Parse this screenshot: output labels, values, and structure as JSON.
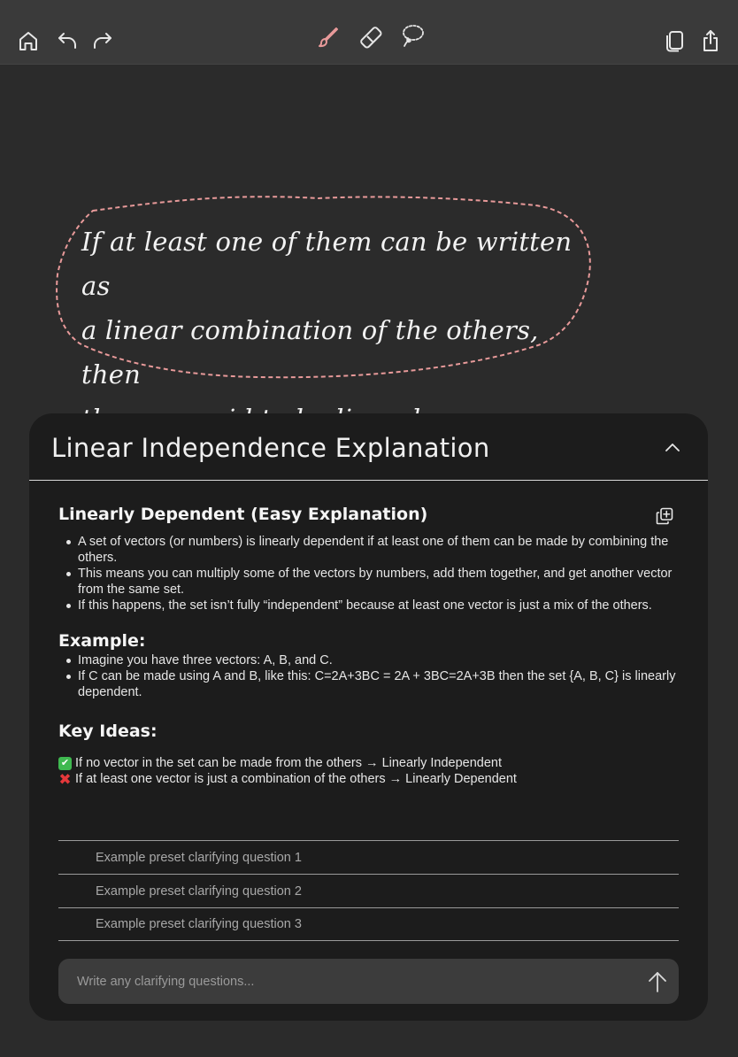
{
  "toolbar": {
    "left_icons": [
      "home-icon",
      "undo-icon",
      "redo-icon"
    ],
    "center_icons": [
      "pen-icon",
      "eraser-icon",
      "lasso-icon"
    ],
    "right_icons": [
      "pages-icon",
      "share-icon"
    ],
    "active_tool": "pen",
    "accent_color": "#e89a9a"
  },
  "note": {
    "lines": [
      "If at least one of them can be written as",
      "a linear combination of the others, then",
      "they are said to be linearly dependent."
    ],
    "lasso_color": "#e89a9a"
  },
  "panel": {
    "title": "Linear Independence Explanation",
    "section_title": "Linearly Dependent (Easy Explanation)",
    "bullets": [
      "A set of vectors (or numbers) is linearly dependent if at least one of them can be made by combining the others.",
      "This means you can multiply some of the vectors by numbers, add them together, and get another vector from the same set.",
      "If this happens, the set isn’t fully “independent” because at least one vector is just a mix of the others."
    ],
    "example_title": "Example:",
    "example_bullets": [
      "Imagine you have three vectors: A, B, and C.",
      "If C can be made using A and B, like this: C=2A+3BC = 2A + 3BC=2A+3B then the set {A, B, C} is linearly dependent."
    ],
    "key_title": "Key Ideas:",
    "key_lines": [
      {
        "mark": "✔",
        "text": "If no vector in the set can be made from the others → Linearly Independent"
      },
      {
        "mark": "✖",
        "text": "If at least one vector is just a combination of the others → Linearly Dependent"
      }
    ],
    "questions": [
      "Example preset clarifying question 1",
      "Example preset clarifying question 2",
      "Example preset clarifying question 3"
    ],
    "input_placeholder": "Write any clarifying questions..."
  }
}
